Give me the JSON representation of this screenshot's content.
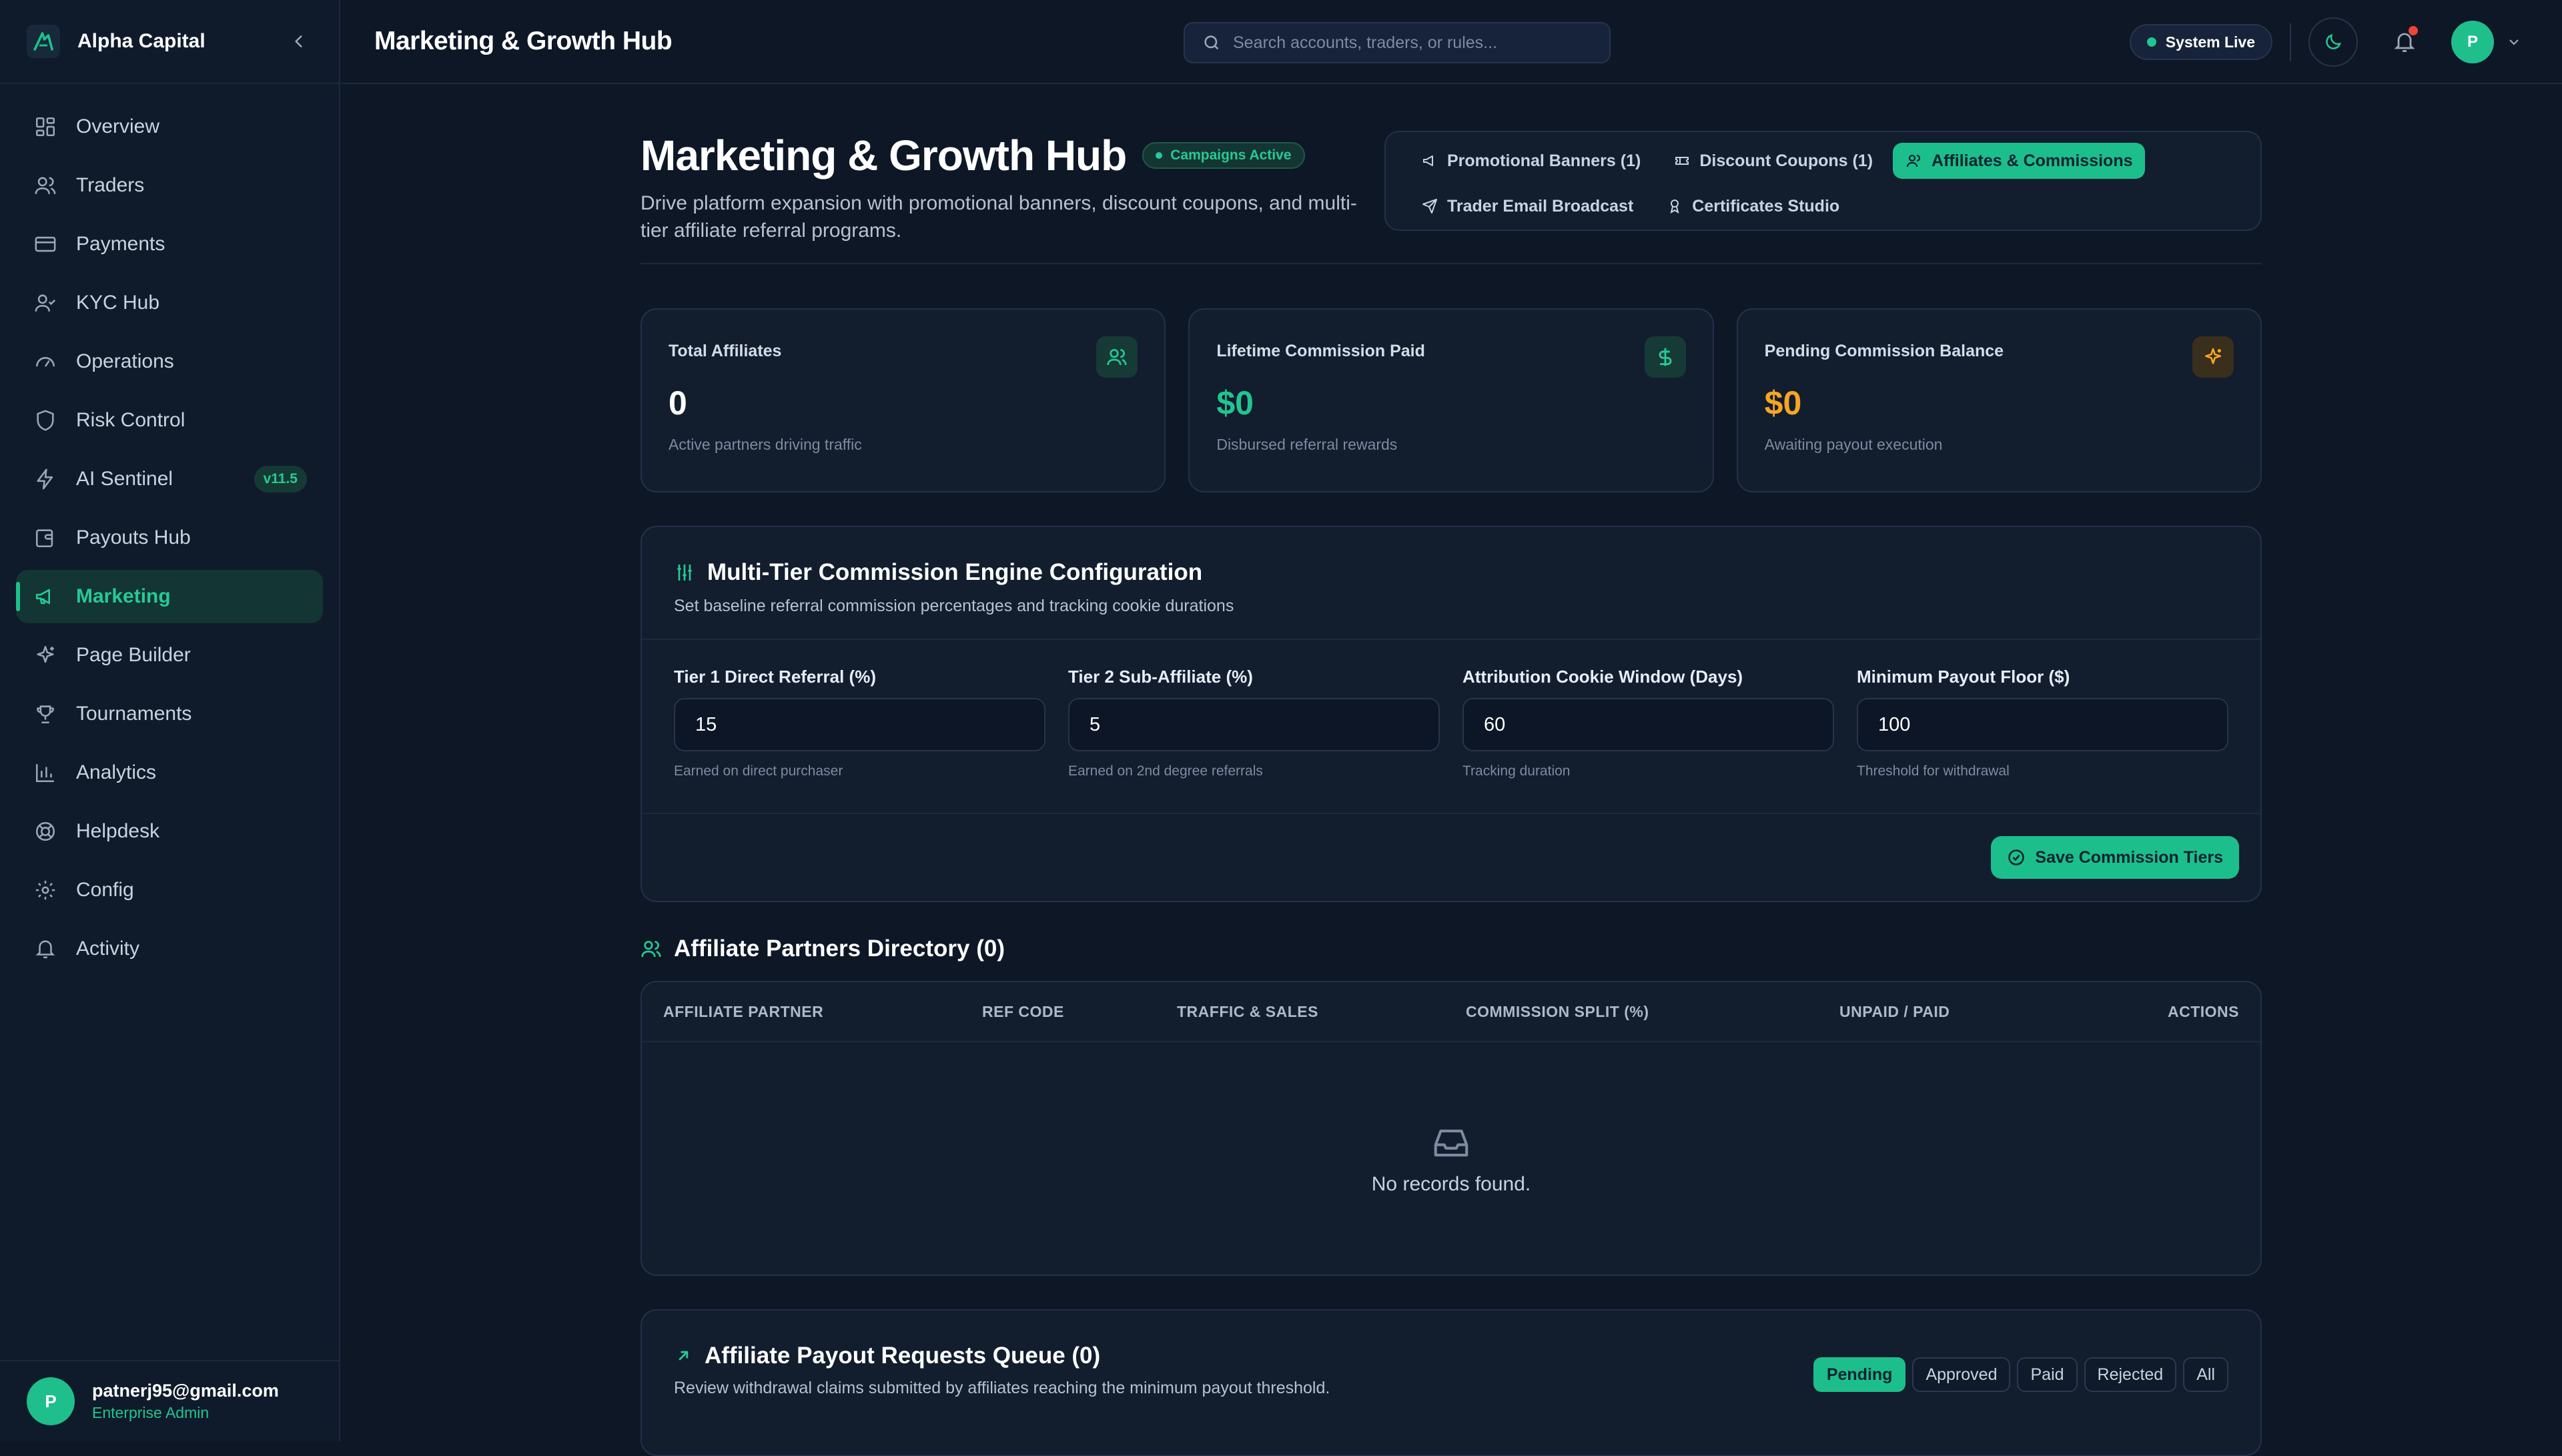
{
  "brand": {
    "name": "Alpha Capital"
  },
  "sidebar": {
    "items": [
      {
        "label": "Overview",
        "icon": "grid-icon"
      },
      {
        "label": "Traders",
        "icon": "users-icon"
      },
      {
        "label": "Payments",
        "icon": "credit-card-icon"
      },
      {
        "label": "KYC Hub",
        "icon": "user-check-icon"
      },
      {
        "label": "Operations",
        "icon": "gauge-icon"
      },
      {
        "label": "Risk Control",
        "icon": "shield-icon"
      },
      {
        "label": "AI Sentinel",
        "icon": "zap-icon",
        "badge": "v11.5"
      },
      {
        "label": "Payouts Hub",
        "icon": "wallet-icon"
      },
      {
        "label": "Marketing",
        "icon": "megaphone-icon",
        "active": true
      },
      {
        "label": "Page Builder",
        "icon": "sparkles-icon"
      },
      {
        "label": "Tournaments",
        "icon": "trophy-icon"
      },
      {
        "label": "Analytics",
        "icon": "bar-chart-icon"
      },
      {
        "label": "Helpdesk",
        "icon": "life-buoy-icon"
      },
      {
        "label": "Config",
        "icon": "gear-icon"
      },
      {
        "label": "Activity",
        "icon": "bell-icon"
      }
    ]
  },
  "user": {
    "email": "patnerj95@gmail.com",
    "role": "Enterprise Admin",
    "initial": "P"
  },
  "topbar": {
    "title": "Marketing & Growth Hub",
    "search_placeholder": "Search accounts, traders, or rules...",
    "status": "System Live",
    "avatar_initial": "P"
  },
  "page": {
    "title": "Marketing & Growth Hub",
    "status_pill": "Campaigns Active",
    "description": "Drive platform expansion with promotional banners, discount coupons, and multi-tier affiliate referral programs."
  },
  "tabs": [
    {
      "label": "Promotional Banners (1)",
      "icon": "megaphone-icon"
    },
    {
      "label": "Discount Coupons (1)",
      "icon": "ticket-icon"
    },
    {
      "label": "Affiliates & Commissions",
      "icon": "users-icon",
      "active": true
    },
    {
      "label": "Trader Email Broadcast",
      "icon": "send-icon"
    },
    {
      "label": "Certificates Studio",
      "icon": "award-icon"
    }
  ],
  "stats": [
    {
      "label": "Total Affiliates",
      "value": "0",
      "sub": "Active partners driving traffic",
      "icon": "users-icon"
    },
    {
      "label": "Lifetime Commission Paid",
      "value": "$0",
      "sub": "Disbursed referral rewards",
      "icon": "dollar-icon"
    },
    {
      "label": "Pending Commission Balance",
      "value": "$0",
      "sub": "Awaiting payout execution",
      "icon": "sparkles-icon"
    }
  ],
  "commission": {
    "title": "Multi-Tier Commission Engine Configuration",
    "subtitle": "Set baseline referral commission percentages and tracking cookie durations",
    "fields": [
      {
        "label": "Tier 1 Direct Referral (%)",
        "value": "15",
        "help": "Earned on direct purchaser"
      },
      {
        "label": "Tier 2 Sub-Affiliate (%)",
        "value": "5",
        "help": "Earned on 2nd degree referrals"
      },
      {
        "label": "Attribution Cookie Window (Days)",
        "value": "60",
        "help": "Tracking duration"
      },
      {
        "label": "Minimum Payout Floor ($)",
        "value": "100",
        "help": "Threshold for withdrawal"
      }
    ],
    "save_label": "Save Commission Tiers"
  },
  "directory": {
    "title": "Affiliate Partners Directory (0)",
    "columns": [
      "AFFILIATE PARTNER",
      "REF CODE",
      "TRAFFIC & SALES",
      "COMMISSION SPLIT (%)",
      "UNPAID / PAID",
      "ACTIONS"
    ],
    "empty_text": "No records found."
  },
  "queue": {
    "title": "Affiliate Payout Requests Queue (0)",
    "subtitle": "Review withdrawal claims submitted by affiliates reaching the minimum payout threshold.",
    "filters": [
      "Pending",
      "Approved",
      "Paid",
      "Rejected",
      "All"
    ],
    "active_filter": "Pending"
  },
  "colors": {
    "accent": "#1cbf8b",
    "amber": "#f5a623",
    "background": "#0e1726",
    "card": "#121d2e"
  }
}
